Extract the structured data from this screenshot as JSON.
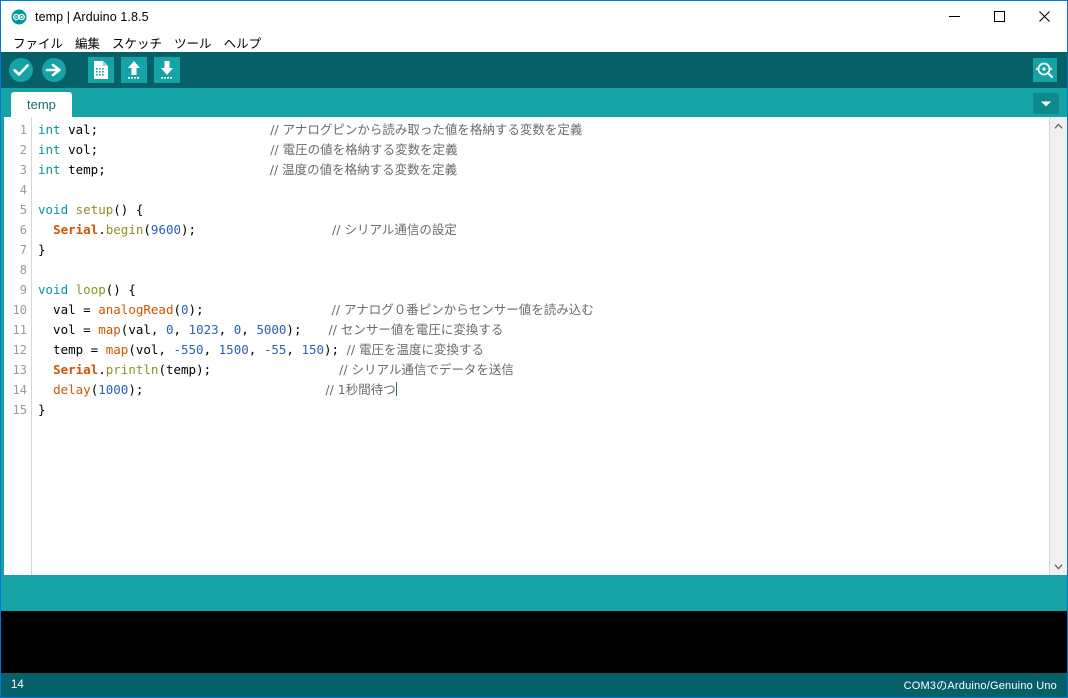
{
  "window": {
    "title": "temp | Arduino 1.8.5",
    "app_icon": "arduino-infinity-icon",
    "controls": {
      "minimize": "—",
      "maximize": "☐",
      "close": "✕"
    },
    "border_color": "#0078d7"
  },
  "menubar": {
    "items": [
      {
        "label": "ファイル",
        "name": "menu-file"
      },
      {
        "label": "編集",
        "name": "menu-edit"
      },
      {
        "label": "スケッチ",
        "name": "menu-sketch"
      },
      {
        "label": "ツール",
        "name": "menu-tools"
      },
      {
        "label": "ヘルプ",
        "name": "menu-help"
      }
    ]
  },
  "toolbar": {
    "background": "#056068",
    "buttons": [
      {
        "name": "verify-button",
        "icon": "check-circle-icon",
        "tooltip": "検証・コンパイル"
      },
      {
        "name": "upload-button",
        "icon": "arrow-right-circle-icon",
        "tooltip": "マイコンボードに書き込む"
      },
      {
        "name": "new-button",
        "icon": "new-document-icon",
        "tooltip": "新規ファイル"
      },
      {
        "name": "open-button",
        "icon": "arrow-up-box-icon",
        "tooltip": "開く"
      },
      {
        "name": "save-button",
        "icon": "arrow-down-box-icon",
        "tooltip": "保存"
      }
    ],
    "serial_monitor": {
      "name": "serial-monitor-button",
      "icon": "magnifier-icon"
    }
  },
  "tabbar": {
    "background": "#15a3a6",
    "tabs": [
      {
        "label": "temp",
        "active": true
      }
    ],
    "menu_icon": "chevron-down-icon"
  },
  "editor": {
    "line_numbers": [
      "1",
      "2",
      "3",
      "4",
      "5",
      "6",
      "7",
      "8",
      "9",
      "10",
      "11",
      "12",
      "13",
      "14",
      "15"
    ],
    "colors": {
      "keyword": "#00979c",
      "function": "#8f8f23",
      "library": "#d35400",
      "builtin": "#d35400",
      "number": "#2b5fb8",
      "comment": "#6b6b6b"
    },
    "lines": [
      {
        "n": 1,
        "code": "int val;",
        "comment": "// アナログピンから読み取った値を格納する変数を定義"
      },
      {
        "n": 2,
        "code": "int vol;",
        "comment": "// 電圧の値を格納する変数を定義"
      },
      {
        "n": 3,
        "code": "int temp;",
        "comment": "// 温度の値を格納する変数を定義"
      },
      {
        "n": 4,
        "code": "",
        "comment": ""
      },
      {
        "n": 5,
        "code": "void setup() {",
        "comment": ""
      },
      {
        "n": 6,
        "code": "  Serial.begin(9600);",
        "comment": "// シリアル通信の設定"
      },
      {
        "n": 7,
        "code": "}",
        "comment": ""
      },
      {
        "n": 8,
        "code": "",
        "comment": ""
      },
      {
        "n": 9,
        "code": "void loop() {",
        "comment": ""
      },
      {
        "n": 10,
        "code": "  val = analogRead(0);",
        "comment": "// アナログ０番ピンからセンサー値を読み込む"
      },
      {
        "n": 11,
        "code": "  vol = map(val, 0, 1023, 0, 5000);",
        "comment": "// センサー値を電圧に変換する"
      },
      {
        "n": 12,
        "code": "  temp = map(vol, -550, 1500, -55, 150);",
        "comment": "// 電圧を温度に変換する"
      },
      {
        "n": 13,
        "code": "  Serial.println(temp);",
        "comment": "// シリアル通信でデータを送信"
      },
      {
        "n": 14,
        "code": "  delay(1000);",
        "comment": "// 1秒間待つ"
      },
      {
        "n": 15,
        "code": "}",
        "comment": ""
      }
    ]
  },
  "scrollbar": {
    "up_arrow": "▲",
    "down_arrow": "▼"
  },
  "console": {
    "text": ""
  },
  "statusbar": {
    "line_number": "14",
    "board_info": "COM3のArduino/Genuino Uno"
  }
}
